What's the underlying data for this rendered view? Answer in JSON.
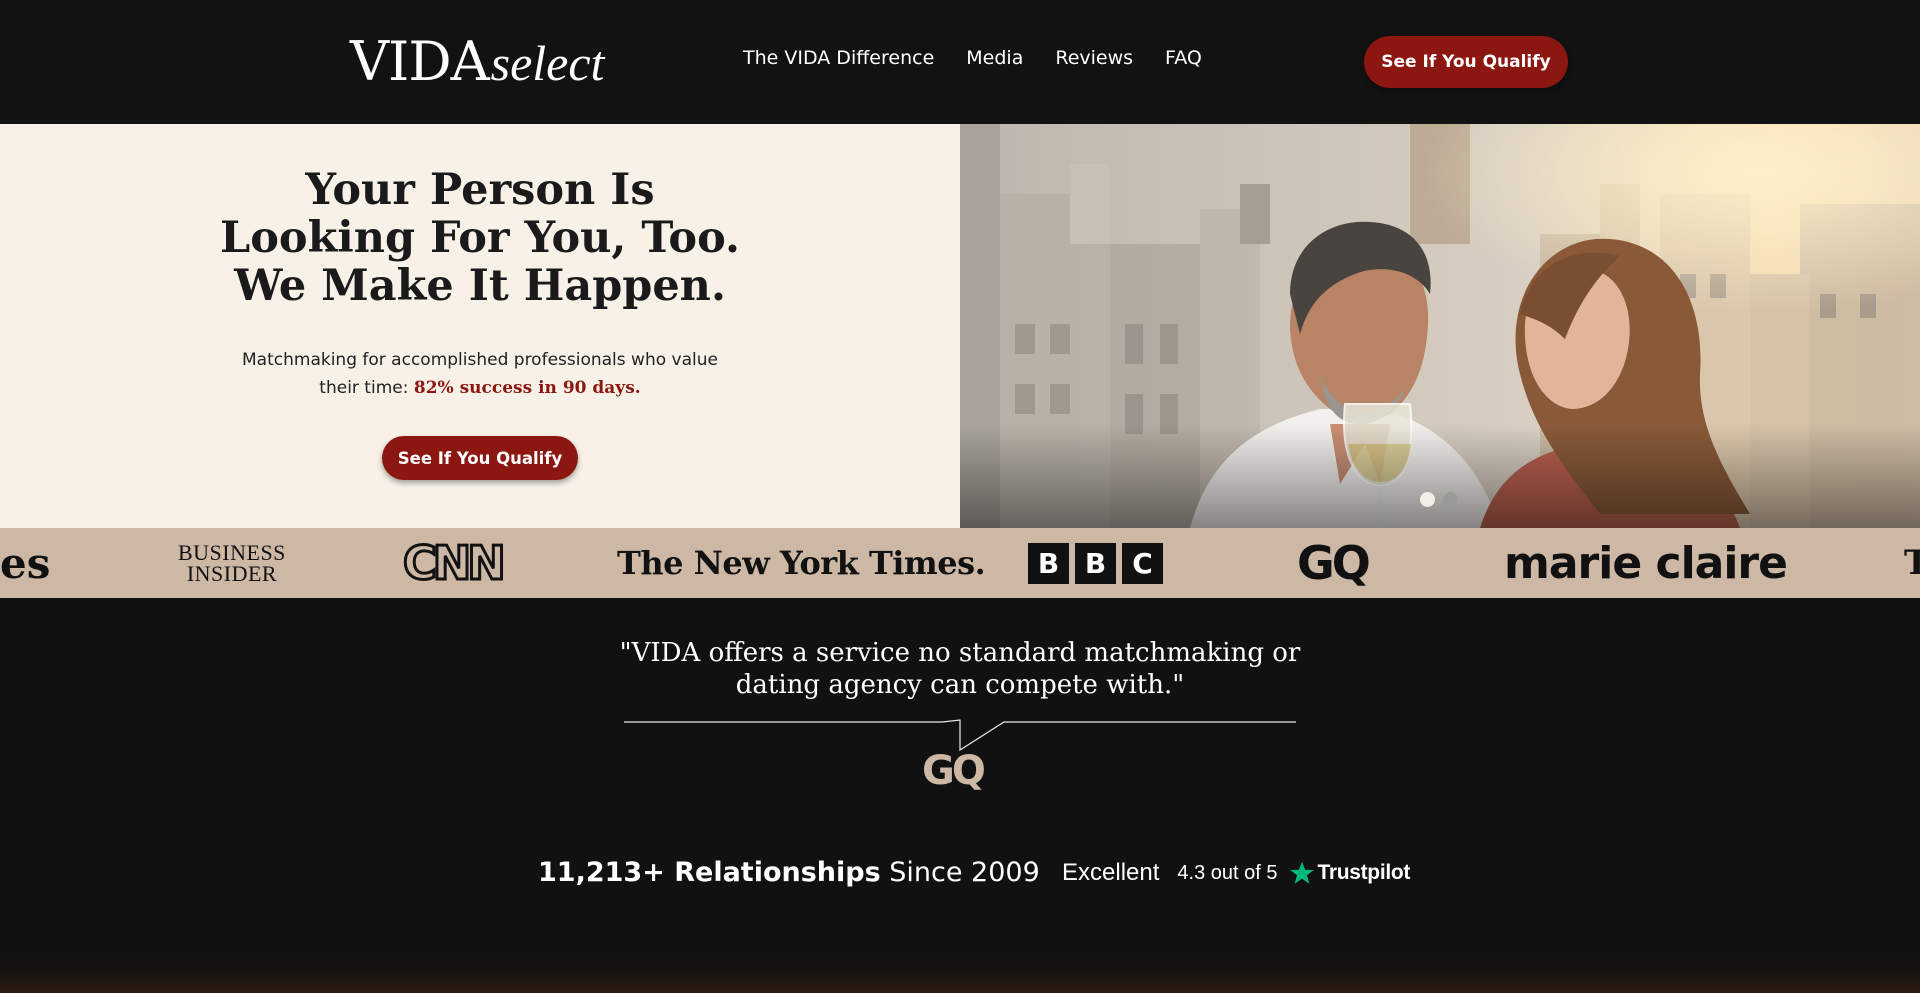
{
  "header": {
    "logo": {
      "main": "VIDA",
      "script": "select"
    },
    "nav": [
      "The VIDA Difference",
      "Media",
      "Reviews",
      "FAQ"
    ],
    "cta_label": "See If You Qualify"
  },
  "hero": {
    "title_lines": [
      "Your Person Is",
      "Looking For You, Too.",
      "We Make It Happen."
    ],
    "subtitle_prefix": "Matchmaking for accomplished professionals who value their time: ",
    "subtitle_highlight": "82% success in 90 days.",
    "cta_label": "See If You Qualify",
    "carousel": {
      "slides": 2,
      "active": 1
    }
  },
  "press": {
    "logos": [
      "es",
      "Business Insider",
      "CNN",
      "The New York Times.",
      "BBC",
      "GQ",
      "marie claire",
      "T"
    ],
    "business_insider_lines": [
      "BUSINESS",
      "INSIDER"
    ],
    "bbc_letters": [
      "B",
      "B",
      "C"
    ]
  },
  "quote": {
    "text_line1": "\"VIDA offers a service no standard matchmaking or",
    "text_line2": "dating agency can compete with.\"",
    "source": "GQ"
  },
  "stats": {
    "count_bold": "11,213+ Relationships",
    "since": " Since 2009"
  },
  "trustpilot": {
    "rating_word": "Excellent",
    "score": "4.3 out of 5",
    "brand": "Trustpilot"
  },
  "colors": {
    "accent_red": "#8c1710",
    "hero_bg": "#f7f1e8",
    "press_bg": "#cdb8a6",
    "page_bg": "#111111",
    "trustpilot_green": "#00b67a"
  }
}
